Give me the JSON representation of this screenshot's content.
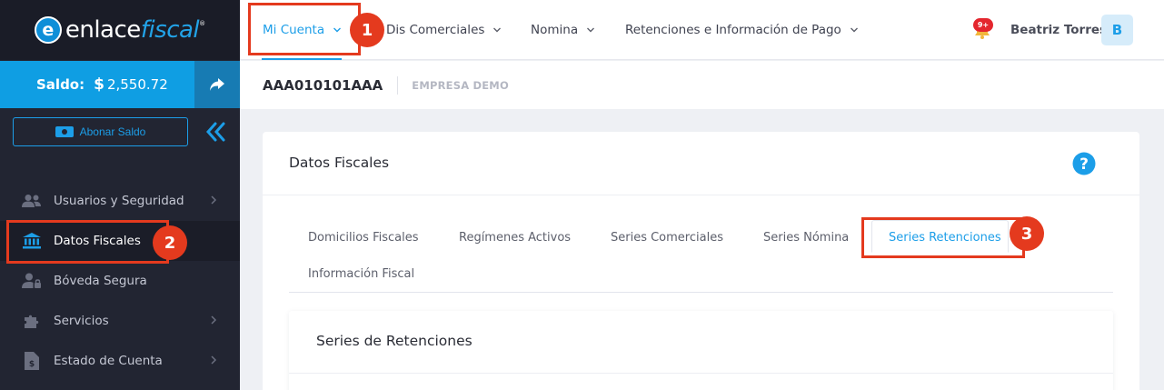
{
  "brand": {
    "name_main": "enlace",
    "name_accent": "fiscal",
    "mark": "e",
    "tm": "®"
  },
  "balance": {
    "label": "Saldo:",
    "currency": "$",
    "amount": "2,550.72"
  },
  "sidebar": {
    "abonar_label": "Abonar Saldo",
    "items": [
      {
        "label": "Usuarios y Seguridad",
        "icon": "users-icon",
        "has_children": true
      },
      {
        "label": "Datos Fiscales",
        "icon": "bank-icon",
        "has_children": false,
        "active": true
      },
      {
        "label": "Bóveda Segura",
        "icon": "user-lock-icon",
        "has_children": false
      },
      {
        "label": "Servicios",
        "icon": "puzzle-icon",
        "has_children": true
      },
      {
        "label": "Estado de Cuenta",
        "icon": "invoice-dollar-icon",
        "has_children": true
      }
    ]
  },
  "topnav": {
    "items": [
      {
        "label": "Mi Cuenta",
        "active": true
      },
      {
        "label": "Dis Comerciales",
        "active": false
      },
      {
        "label": "Nomina",
        "active": false
      },
      {
        "label": "Retenciones e Información de Pago",
        "active": false
      }
    ],
    "notification_badge": "9+",
    "user_name": "Beatriz Torres",
    "avatar_initial": "B"
  },
  "subheader": {
    "rfc": "AAA010101AAA",
    "company": "EMPRESA DEMO"
  },
  "card": {
    "title": "Datos Fiscales",
    "tabs": [
      {
        "label": "Domicilios Fiscales"
      },
      {
        "label": "Regímenes Activos"
      },
      {
        "label": "Series Comerciales"
      },
      {
        "label": "Series Nómina"
      },
      {
        "label": "Series Retenciones",
        "active": true
      },
      {
        "label": "Información Fiscal"
      }
    ],
    "section_title": "Series de Retenciones"
  },
  "annotations": {
    "step1": "1",
    "step2": "2",
    "step3": "3",
    "color": "#e43a1e"
  },
  "colors": {
    "accent": "#1c9ee8",
    "sidebar_bg": "#222532",
    "balance_bg": "#0f9ee3",
    "badge": "#e4262e"
  }
}
